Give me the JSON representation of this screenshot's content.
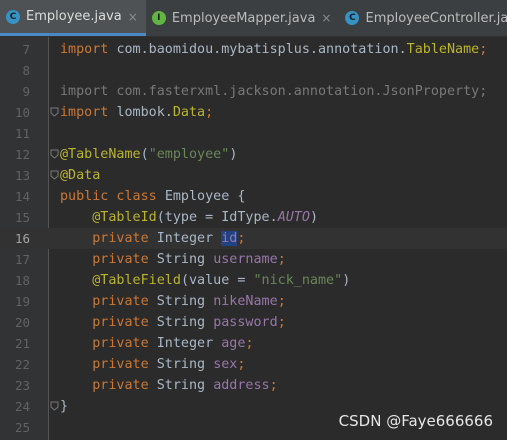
{
  "tabs": [
    {
      "label": "Employee.java",
      "icon": "class-icon",
      "icon_letter": "C",
      "icon_color": "#3592c4",
      "active": true
    },
    {
      "label": "EmployeeMapper.java",
      "icon": "interface-icon",
      "icon_letter": "I",
      "icon_color": "#62b543",
      "active": false
    },
    {
      "label": "EmployeeController.java",
      "icon": "class-icon",
      "icon_letter": "C",
      "icon_color": "#3592c4",
      "active": false
    }
  ],
  "close_glyph": "×",
  "lines": [
    {
      "n": "7",
      "tokens": [
        {
          "t": "import ",
          "c": "kw"
        },
        {
          "t": "com.baomidou.mybatisplus.annotation.",
          "c": ""
        },
        {
          "t": "TableName",
          "c": "ann"
        },
        {
          "t": ";",
          "c": "kw"
        }
      ]
    },
    {
      "n": "8",
      "tokens": []
    },
    {
      "n": "9",
      "tokens": [
        {
          "t": "import com.fasterxml.jackson.annotation.JsonProperty;",
          "c": "dim"
        }
      ]
    },
    {
      "n": "10",
      "fold": true,
      "tokens": [
        {
          "t": "import ",
          "c": "kw"
        },
        {
          "t": "lombok.",
          "c": ""
        },
        {
          "t": "Data",
          "c": "ann"
        },
        {
          "t": ";",
          "c": "kw"
        }
      ]
    },
    {
      "n": "11",
      "tokens": []
    },
    {
      "n": "12",
      "fold": true,
      "tokens": [
        {
          "t": "@TableName",
          "c": "ann"
        },
        {
          "t": "(",
          "c": ""
        },
        {
          "t": "\"employee\"",
          "c": "str"
        },
        {
          "t": ")",
          "c": ""
        }
      ]
    },
    {
      "n": "13",
      "fold": true,
      "tokens": [
        {
          "t": "@Data",
          "c": "ann"
        }
      ]
    },
    {
      "n": "14",
      "tokens": [
        {
          "t": "public class ",
          "c": "kw"
        },
        {
          "t": "Employee {",
          "c": ""
        }
      ]
    },
    {
      "n": "15",
      "tokens": [
        {
          "t": "    ",
          "c": ""
        },
        {
          "t": "@TableId",
          "c": "ann"
        },
        {
          "t": "(type = IdType.",
          "c": ""
        },
        {
          "t": "AUTO",
          "c": "cst"
        },
        {
          "t": ")",
          "c": ""
        }
      ]
    },
    {
      "n": "16",
      "current": true,
      "tokens": [
        {
          "t": "    private ",
          "c": "kw"
        },
        {
          "t": "Integer ",
          "c": ""
        },
        {
          "t": "id",
          "c": "fld sel"
        },
        {
          "t": ";",
          "c": "kw"
        }
      ]
    },
    {
      "n": "17",
      "tokens": [
        {
          "t": "    private ",
          "c": "kw"
        },
        {
          "t": "String ",
          "c": ""
        },
        {
          "t": "username",
          "c": "fld"
        },
        {
          "t": ";",
          "c": "kw"
        }
      ]
    },
    {
      "n": "18",
      "tokens": [
        {
          "t": "    ",
          "c": ""
        },
        {
          "t": "@TableField",
          "c": "ann"
        },
        {
          "t": "(value = ",
          "c": ""
        },
        {
          "t": "\"nick_name\"",
          "c": "str"
        },
        {
          "t": ")",
          "c": ""
        }
      ]
    },
    {
      "n": "19",
      "tokens": [
        {
          "t": "    private ",
          "c": "kw"
        },
        {
          "t": "String ",
          "c": ""
        },
        {
          "t": "nikeName",
          "c": "fld"
        },
        {
          "t": ";",
          "c": "kw"
        }
      ]
    },
    {
      "n": "20",
      "tokens": [
        {
          "t": "    private ",
          "c": "kw"
        },
        {
          "t": "String ",
          "c": ""
        },
        {
          "t": "password",
          "c": "fld"
        },
        {
          "t": ";",
          "c": "kw"
        }
      ]
    },
    {
      "n": "21",
      "tokens": [
        {
          "t": "    private ",
          "c": "kw"
        },
        {
          "t": "Integer ",
          "c": ""
        },
        {
          "t": "age",
          "c": "fld"
        },
        {
          "t": ";",
          "c": "kw"
        }
      ]
    },
    {
      "n": "22",
      "tokens": [
        {
          "t": "    private ",
          "c": "kw"
        },
        {
          "t": "String ",
          "c": ""
        },
        {
          "t": "sex",
          "c": "fld"
        },
        {
          "t": ";",
          "c": "kw"
        }
      ]
    },
    {
      "n": "23",
      "tokens": [
        {
          "t": "    private ",
          "c": "kw"
        },
        {
          "t": "String ",
          "c": ""
        },
        {
          "t": "address",
          "c": "fld"
        },
        {
          "t": ";",
          "c": "kw"
        }
      ]
    },
    {
      "n": "24",
      "fold": true,
      "tokens": [
        {
          "t": "}",
          "c": ""
        }
      ]
    },
    {
      "n": "25",
      "tokens": []
    }
  ],
  "watermark": "CSDN @Faye666666"
}
